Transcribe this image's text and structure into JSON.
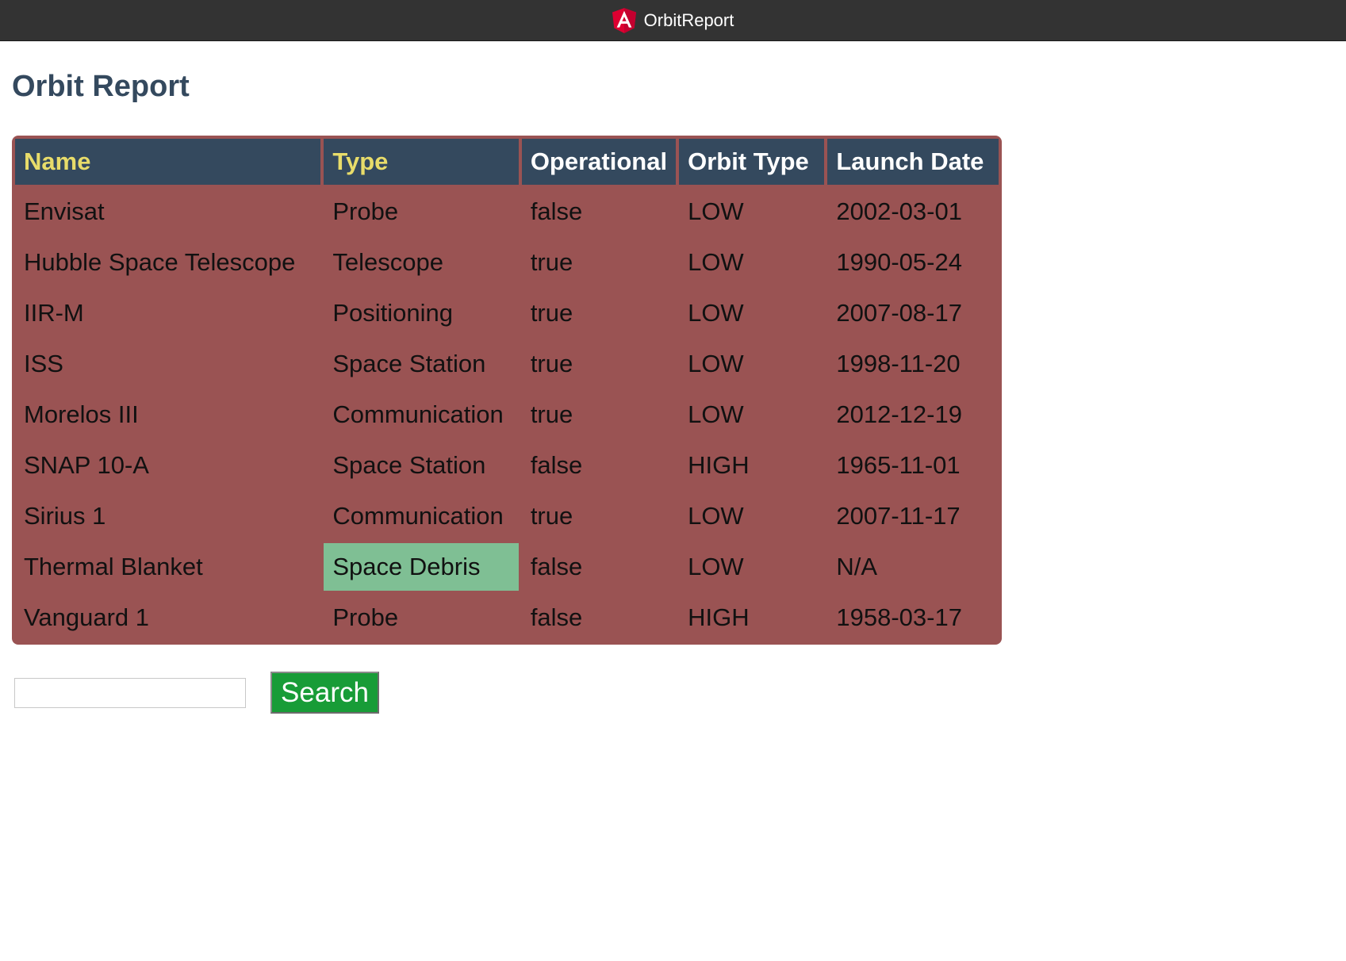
{
  "window": {
    "title": "OrbitReport",
    "logo_icon": "angular-logo-icon"
  },
  "page": {
    "heading": "Orbit Report"
  },
  "table": {
    "columns": [
      "Name",
      "Type",
      "Operational",
      "Orbit Type",
      "Launch Date"
    ],
    "sortable_columns": [
      "Name",
      "Type"
    ],
    "rows": [
      [
        "Envisat",
        "Probe",
        "false",
        "LOW",
        "2002-03-01"
      ],
      [
        "Hubble Space Telescope",
        "Telescope",
        "true",
        "LOW",
        "1990-05-24"
      ],
      [
        "IIR-M",
        "Positioning",
        "true",
        "LOW",
        "2007-08-17"
      ],
      [
        "ISS",
        "Space Station",
        "true",
        "LOW",
        "1998-11-20"
      ],
      [
        "Morelos III",
        "Communication",
        "true",
        "LOW",
        "2012-12-19"
      ],
      [
        "SNAP 10-A",
        "Space Station",
        "false",
        "HIGH",
        "1965-11-01"
      ],
      [
        "Sirius 1",
        "Communication",
        "true",
        "LOW",
        "2007-11-17"
      ],
      [
        "Thermal Blanket",
        "Space Debris",
        "false",
        "LOW",
        "N/A"
      ],
      [
        "Vanguard 1",
        "Probe",
        "false",
        "HIGH",
        "1958-03-17"
      ]
    ]
  },
  "search": {
    "value": "",
    "button_label": "Search"
  },
  "colors": {
    "titlebar": "#333333",
    "heading": "#34495e",
    "table_background": "#9a5353",
    "header_background": "#34495e",
    "sortable_header_text": "#e8dc6a",
    "space_debris_highlight": "#7fbf94",
    "search_button": "#189c37"
  }
}
